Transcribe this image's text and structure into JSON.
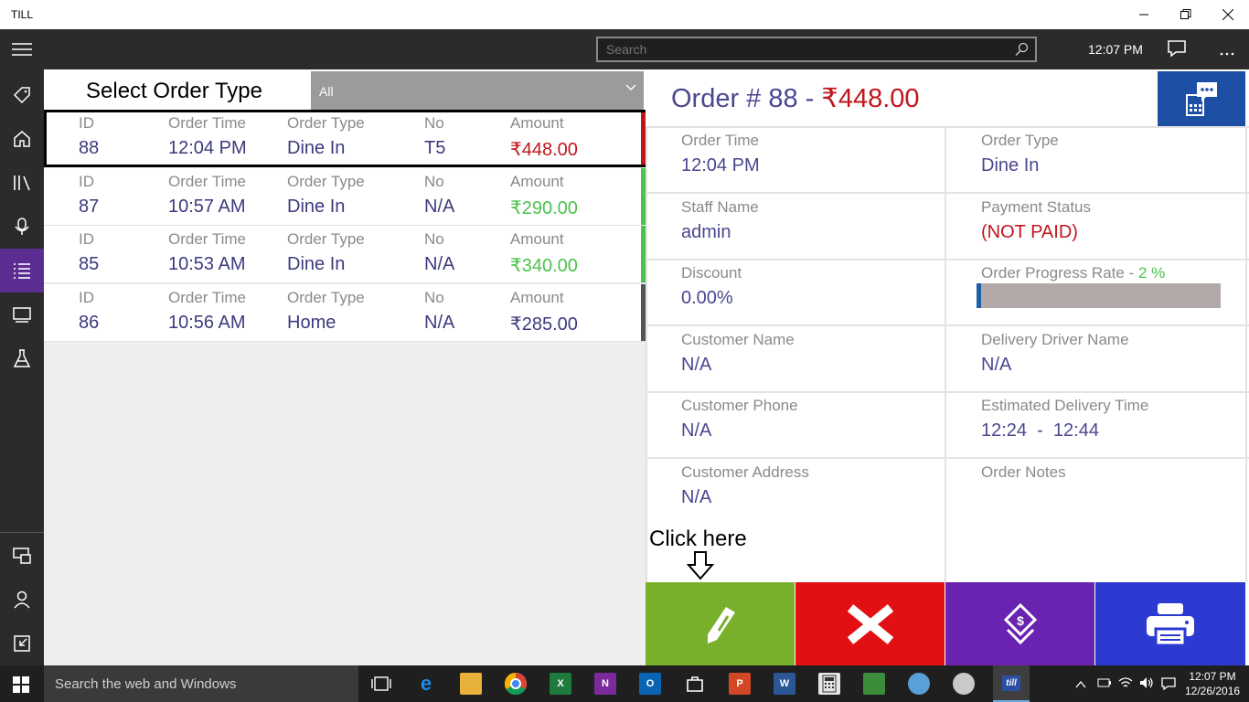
{
  "window": {
    "title": "TILL"
  },
  "topbar": {
    "search_placeholder": "Search",
    "time": "12:07 PM"
  },
  "left": {
    "select_label": "Select Order Type",
    "select_value": "All",
    "columns": [
      "ID",
      "Order Time",
      "Order Type",
      "No",
      "Amount"
    ],
    "orders": [
      {
        "id": "88",
        "time": "12:04 PM",
        "type": "Dine In",
        "no": "T5",
        "amount": "₹448.00",
        "amount_color": "#c0161d",
        "accent": "#c0161d"
      },
      {
        "id": "87",
        "time": "10:57 AM",
        "type": "Dine In",
        "no": "N/A",
        "amount": "₹290.00",
        "amount_color": "#4cc24c",
        "accent": "#4cc24c"
      },
      {
        "id": "85",
        "time": "10:53 AM",
        "type": "Dine In",
        "no": "N/A",
        "amount": "₹340.00",
        "amount_color": "#4cc24c",
        "accent": "#4cc24c"
      },
      {
        "id": "86",
        "time": "10:56 AM",
        "type": "Home Delivery",
        "no": "N/A",
        "amount": "₹285.00",
        "amount_color": "#3c3a7d",
        "accent": "#555555"
      }
    ]
  },
  "detail": {
    "title_prefix": "Order # 88 - ",
    "title_amount": "₹448.00",
    "order_time_label": "Order Time",
    "order_time": "12:04 PM",
    "order_type_label": "Order Type",
    "order_type": "Dine In",
    "staff_label": "Staff Name",
    "staff": "admin",
    "payment_label": "Payment Status",
    "payment": "(NOT PAID)",
    "discount_label": "Discount",
    "discount": "0.00%",
    "progress_label": "Order Progress Rate - ",
    "progress_pct": "2 %",
    "progress_value": 0.02,
    "customer_label": "Customer Name",
    "customer": "N/A",
    "driver_label": "Delivery Driver Name",
    "driver": "N/A",
    "phone_label": "Customer Phone",
    "phone": "N/A",
    "eta_label": "Estimated Delivery Time",
    "eta": "12:24  -  12:44",
    "address_label": "Customer Address",
    "address": "N/A",
    "notes_label": "Order Notes",
    "click_here": "Click here"
  },
  "actions": [
    {
      "name": "edit-order",
      "icon": "pencil-icon",
      "color": "#78b02c"
    },
    {
      "name": "cancel-order",
      "icon": "close-icon",
      "color": "#e31013"
    },
    {
      "name": "payment",
      "icon": "payment-icon",
      "color": "#6a23b0"
    },
    {
      "name": "print",
      "icon": "printer-icon",
      "color": "#2c3ad2"
    }
  ],
  "taskbar": {
    "search_placeholder": "Search the web and Windows",
    "time": "12:07 PM",
    "date": "12/26/2016"
  }
}
